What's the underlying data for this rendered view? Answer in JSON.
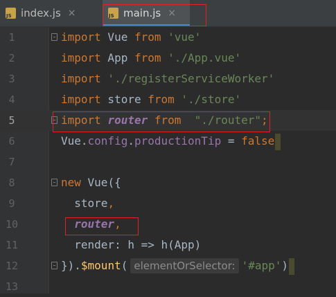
{
  "tabs": [
    {
      "label": "index.js",
      "icon": "js-file-icon",
      "icon_text": "JS",
      "active": false
    },
    {
      "label": "main.js",
      "icon": "js-file-icon",
      "icon_text": "JS",
      "active": true
    }
  ],
  "close_glyph": "×",
  "gutter": {
    "line_numbers": [
      "1",
      "2",
      "3",
      "4",
      "5",
      "6",
      "7",
      "8",
      "9",
      "10",
      "11",
      "12",
      "13"
    ],
    "current_line": "5"
  },
  "code": {
    "l1": {
      "kw1": "import",
      "id": " Vue ",
      "kw2": "from",
      "str": " 'vue'"
    },
    "l2": {
      "kw1": "import",
      "id": " App ",
      "kw2": "from",
      "str": " './App.vue'"
    },
    "l3": {
      "kw1": "import",
      "str": " './registerServiceWorker'"
    },
    "l4": {
      "kw1": "import",
      "id": " store ",
      "kw2": "from",
      "str": " './store'"
    },
    "l5": {
      "kw1": "import",
      "id": "router",
      "kw2": "from",
      "str": "\"./router\"",
      "semi": ";"
    },
    "l6": {
      "obj": "Vue.",
      "p1": "config",
      "dot": ".",
      "p2": "productionTip",
      "eq": " = ",
      "kw": "false"
    },
    "l8": {
      "kw": "new",
      "rest": " Vue({"
    },
    "l9": {
      "id": "  store",
      "comma": ","
    },
    "l10": {
      "id": "router",
      "comma": ","
    },
    "l11": {
      "id": "  render: h => h(App)"
    },
    "l12": {
      "pre": "}).",
      "fn": "$mount",
      "paren": "(",
      "hint": "elementOrSelector:",
      "str": "'#app'",
      "close": ")"
    }
  },
  "colors": {
    "keyword": "#cc7832",
    "string": "#6a8759",
    "property": "#9876aa",
    "function": "#ffc66d",
    "highlight_box": "#e0202a"
  }
}
